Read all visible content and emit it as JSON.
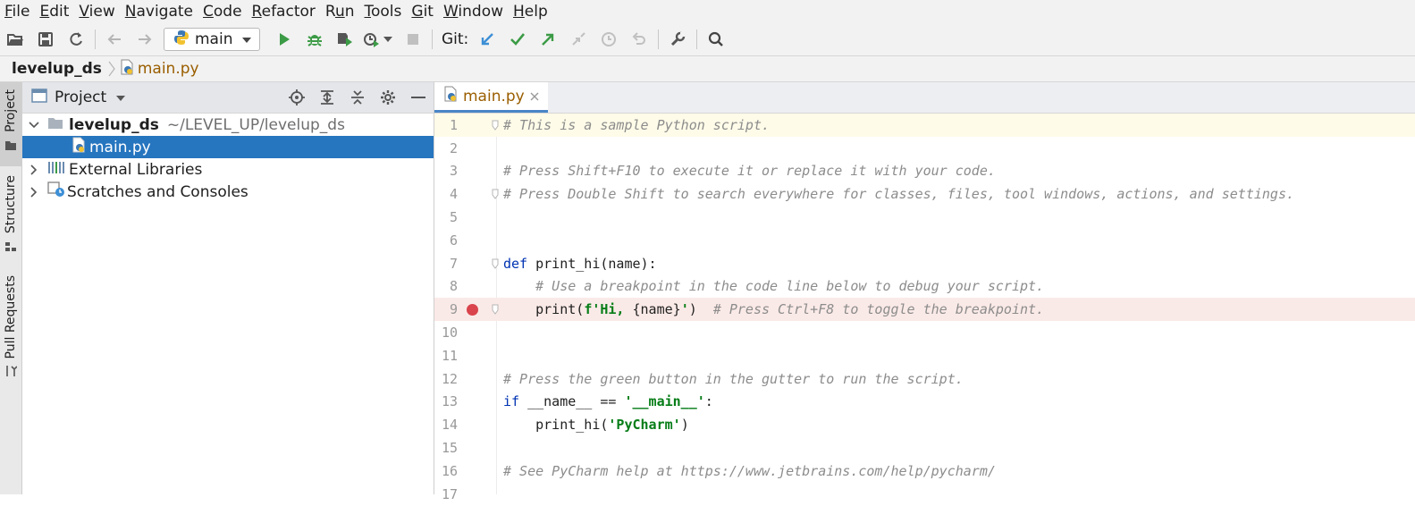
{
  "menu": [
    {
      "pre": "",
      "u": "F",
      "post": "ile"
    },
    {
      "pre": "",
      "u": "E",
      "post": "dit"
    },
    {
      "pre": "",
      "u": "V",
      "post": "iew"
    },
    {
      "pre": "",
      "u": "N",
      "post": "avigate"
    },
    {
      "pre": "",
      "u": "C",
      "post": "ode"
    },
    {
      "pre": "",
      "u": "R",
      "post": "efactor"
    },
    {
      "pre": "R",
      "u": "u",
      "post": "n"
    },
    {
      "pre": "",
      "u": "T",
      "post": "ools"
    },
    {
      "pre": "",
      "u": "G",
      "post": "it"
    },
    {
      "pre": "",
      "u": "W",
      "post": "indow"
    },
    {
      "pre": "",
      "u": "H",
      "post": "elp"
    }
  ],
  "toolbar": {
    "run_config": "main",
    "git_label": "Git:"
  },
  "breadcrumbs": {
    "root": "levelup_ds",
    "file": "main.py"
  },
  "sidebar_tabs": [
    "Project",
    "Structure",
    "Pull Requests"
  ],
  "project": {
    "title": "Project",
    "tree": {
      "root_name": "levelup_ds",
      "root_path": "~/LEVEL_UP/levelup_ds",
      "file": "main.py",
      "external": "External Libraries",
      "scratches": "Scratches and Consoles"
    }
  },
  "editor": {
    "tab": "main.py",
    "lines": [
      {
        "n": "1",
        "segs": [
          {
            "t": "# This is a sample Python script.",
            "c": "cmt"
          }
        ]
      },
      {
        "n": "2",
        "segs": []
      },
      {
        "n": "3",
        "segs": [
          {
            "t": "# Press Shift+F10 to execute it or replace it with your code.",
            "c": "cmt"
          }
        ]
      },
      {
        "n": "4",
        "segs": [
          {
            "t": "# Press Double Shift to search everywhere for classes, files, tool windows, actions, and settings.",
            "c": "cmt"
          }
        ]
      },
      {
        "n": "5",
        "segs": []
      },
      {
        "n": "6",
        "segs": []
      },
      {
        "n": "7",
        "segs": [
          {
            "t": "def",
            "c": "kw"
          },
          {
            "t": " print_hi(name):",
            "c": ""
          }
        ]
      },
      {
        "n": "8",
        "segs": [
          {
            "t": "    # Use a breakpoint in the code line below to debug your script.",
            "c": "cmt"
          }
        ]
      },
      {
        "n": "9",
        "segs": [
          {
            "t": "    print(",
            "c": ""
          },
          {
            "t": "f'Hi, ",
            "c": "str"
          },
          {
            "t": "{name}",
            "c": ""
          },
          {
            "t": "'",
            "c": "str"
          },
          {
            "t": ")  ",
            "c": ""
          },
          {
            "t": "# Press Ctrl+F8 to toggle the breakpoint.",
            "c": "cmt"
          }
        ]
      },
      {
        "n": "10",
        "segs": []
      },
      {
        "n": "11",
        "segs": []
      },
      {
        "n": "12",
        "segs": [
          {
            "t": "# Press the green button in the gutter to run the script.",
            "c": "cmt"
          }
        ]
      },
      {
        "n": "13",
        "segs": [
          {
            "t": "if",
            "c": "kw"
          },
          {
            "t": " __name__ == ",
            "c": ""
          },
          {
            "t": "'__main__'",
            "c": "str"
          },
          {
            "t": ":",
            "c": ""
          }
        ]
      },
      {
        "n": "14",
        "segs": [
          {
            "t": "    print_hi(",
            "c": ""
          },
          {
            "t": "'PyCharm'",
            "c": "str"
          },
          {
            "t": ")",
            "c": ""
          }
        ]
      },
      {
        "n": "15",
        "segs": []
      },
      {
        "n": "16",
        "segs": [
          {
            "t": "# See PyCharm help at https://www.jetbrains.com/help/pycharm/",
            "c": "cmt"
          }
        ]
      },
      {
        "n": "17",
        "segs": []
      }
    ]
  },
  "colors": {
    "selection": "#2675bf",
    "breakpoint": "#d9444d",
    "run_green": "#3c9b46",
    "git_blue": "#3d8fd6"
  },
  "icons": [
    "open-folder-icon",
    "save-icon",
    "sync-icon",
    "back-arrow-icon",
    "forward-arrow-icon",
    "python-icon",
    "run-icon",
    "debug-icon",
    "coverage-icon",
    "profile-icon",
    "stop-icon",
    "git-update-icon",
    "git-commit-icon",
    "git-push-icon",
    "git-fetch-icon",
    "history-icon",
    "rollback-icon",
    "settings-wrench-icon",
    "search-icon"
  ]
}
